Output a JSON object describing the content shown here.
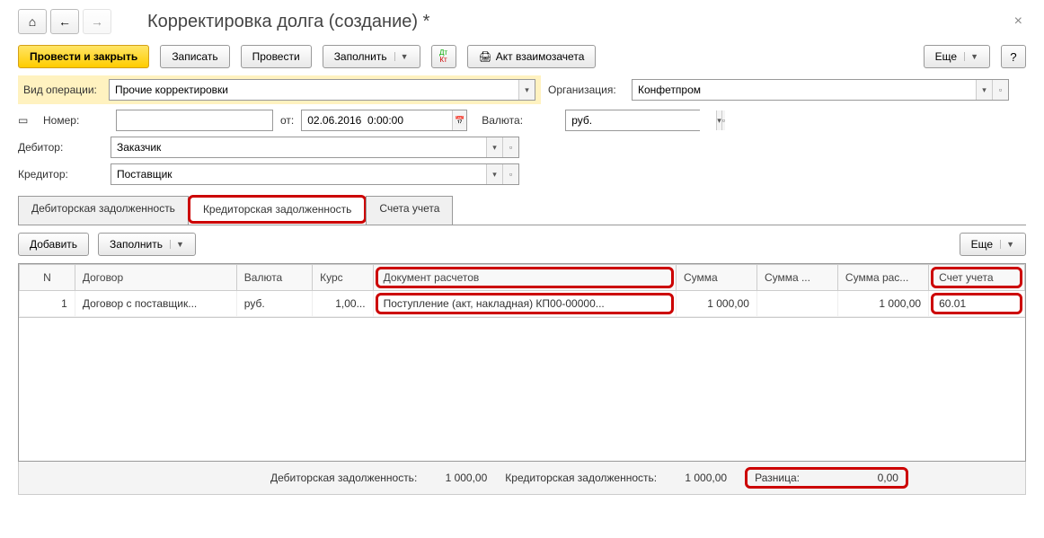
{
  "title": "Корректировка долга (создание) *",
  "toolbar": {
    "post_close": "Провести и закрыть",
    "save": "Записать",
    "post": "Провести",
    "fill": "Заполнить",
    "print_act": "Акт взаимозачета",
    "more": "Еще",
    "help": "?"
  },
  "form": {
    "operation_label": "Вид операции:",
    "operation_value": "Прочие корректировки",
    "org_label": "Организация:",
    "org_value": "Конфетпром",
    "number_label": "Номер:",
    "number_value": "",
    "date_label": "от:",
    "date_value": "02.06.2016  0:00:00",
    "currency_label": "Валюта:",
    "currency_value": "руб.",
    "debtor_label": "Дебитор:",
    "debtor_value": "Заказчик",
    "creditor_label": "Кредитор:",
    "creditor_value": "Поставщик"
  },
  "tabs": {
    "debit": "Дебиторская задолженность",
    "credit": "Кредиторская задолженность",
    "accounts": "Счета учета"
  },
  "subtoolbar": {
    "add": "Добавить",
    "fill": "Заполнить",
    "more": "Еще"
  },
  "grid": {
    "headers": {
      "n": "N",
      "contract": "Договор",
      "currency": "Валюта",
      "rate": "Курс",
      "doc": "Документ расчетов",
      "sum": "Сумма",
      "sum2": "Сумма ...",
      "sum3": "Сумма рас...",
      "account": "Счет учета"
    },
    "rows": [
      {
        "n": "1",
        "contract": "Договор с поставщик...",
        "currency": "руб.",
        "rate": "1,00...",
        "doc": "Поступление (акт, накладная) КП00-00000...",
        "sum": "1 000,00",
        "sum2": "",
        "sum3": "1 000,00",
        "account": "60.01"
      }
    ]
  },
  "footer": {
    "debit_label": "Дебиторская задолженность:",
    "debit_value": "1 000,00",
    "credit_label": "Кредиторская задолженность:",
    "credit_value": "1 000,00",
    "diff_label": "Разница:",
    "diff_value": "0,00"
  }
}
